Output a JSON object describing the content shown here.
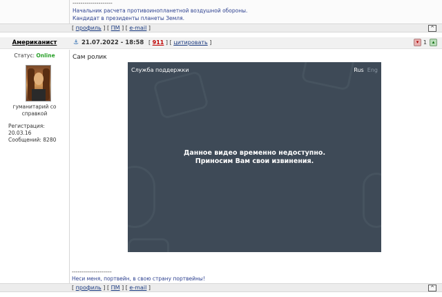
{
  "prev_post": {
    "signature_separator": "--------------------",
    "signature_line1": "Начальник расчета противоинопланетной воздушной обороны.",
    "signature_line2": "Кандидат в президенты планеты Земля.",
    "actions": {
      "profile": "профиль",
      "pm": "ПМ",
      "email": "e-mail",
      "to_top": "^"
    }
  },
  "post": {
    "author": "Американист",
    "date": "21.07.2022 - 18:58",
    "number": "911",
    "quote": "цитировать",
    "rating": {
      "minus_icon": "thumb-down-icon",
      "count": "1",
      "plus_icon": "thumb-up-icon"
    },
    "user": {
      "status_label": "Статус:",
      "status_value": "Online",
      "title_line1": "гуманитарий со",
      "title_line2": "справкой",
      "registration": "Регистрация: 20.03.16",
      "messages": "Сообщений: 8280"
    },
    "text": "Сам ролик",
    "video": {
      "support": "Служба поддержки",
      "lang_active": "Rus",
      "lang_inactive": "Eng",
      "message_line1": "Данное видео временно недоступно.",
      "message_line2": "Приносим Вам свои извинения."
    },
    "signature_separator": "--------------------",
    "signature": "Неси меня, портвейн, в свою страну портвейны!",
    "actions": {
      "profile": "профиль",
      "pm": "ПМ",
      "email": "e-mail",
      "to_top": "^"
    }
  },
  "colors": {
    "link": "#1a3a80",
    "online": "#2aa02a",
    "post_number": "#c00000",
    "video_bg": "#3e4a57"
  }
}
